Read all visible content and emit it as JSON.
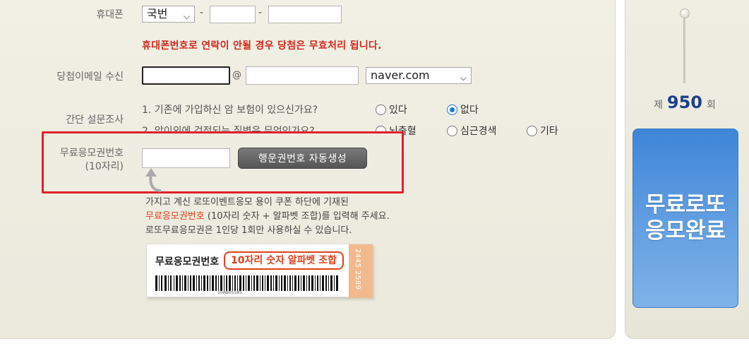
{
  "form": {
    "phone": {
      "label": "휴대폰",
      "prefix_select": "국번",
      "dash": "-",
      "part2": "",
      "part3": ""
    },
    "warning": "휴대폰번호로 연락이 안될 경우 당첨은 무효처리 됩니다.",
    "email": {
      "label": "당첨이메일 수신",
      "id_value": "",
      "at": "@",
      "domain_value": "",
      "domain_select": "naver.com"
    },
    "survey": {
      "label": "간단 설문조사",
      "q1": {
        "text": "1. 기존에 가입하신 암 보험이 있으신가요?",
        "options": [
          "있다",
          "없다"
        ],
        "selected": "없다"
      },
      "q2": {
        "text": "2. 암이외에 걱정되는 질병은 무엇인가요?",
        "options": [
          "뇌출혈",
          "심근경색",
          "기타"
        ]
      }
    },
    "coupon": {
      "label_line1": "무료응모권번호",
      "label_line2": "(10자리)",
      "value": "",
      "generate_button": "행운권번호 자동생성"
    },
    "info": {
      "line1": "가지고 계신 로또이벤트응모 용이 쿠폰 하단에 기재된",
      "line2_red": "무료응모권번호",
      "line2_rest": " (10자리 숫자 + 알파벳 조합)를 입력해 주세요.",
      "line3": "로또무료응모권은 1인당 1회만 사용하실 수 있습니다."
    },
    "ticket": {
      "label": "무료응모권번호",
      "pill": "10자리 숫자 알파벳 조합",
      "stripe_number": "2445 2589",
      "barcode_number": "10AB05585"
    }
  },
  "sidebar": {
    "round_prefix": "제",
    "round_number": "950",
    "round_suffix": "회",
    "submit_line1": "무료로또",
    "submit_line2": "응모완료"
  },
  "colors": {
    "warning": "#d12a1c",
    "highlight": "#e0202a",
    "submit": "#4a8fdc",
    "round": "#1d3f8c"
  }
}
